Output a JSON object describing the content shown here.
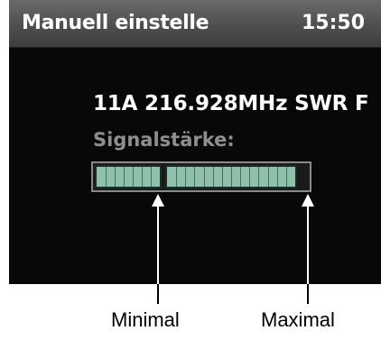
{
  "screen": {
    "title": "Manuell einstelle",
    "time": "15:50",
    "station": "11A 216.928MHz SWR F",
    "signal_label": "Signalstärke:",
    "signal_level_fraction": 0.95,
    "colors": {
      "bar_fill": "#8fc0ac",
      "background": "#080808",
      "label_grey": "#8f8f8f"
    }
  },
  "annotations": {
    "min_label": "Minimal",
    "max_label": "Maximal"
  }
}
